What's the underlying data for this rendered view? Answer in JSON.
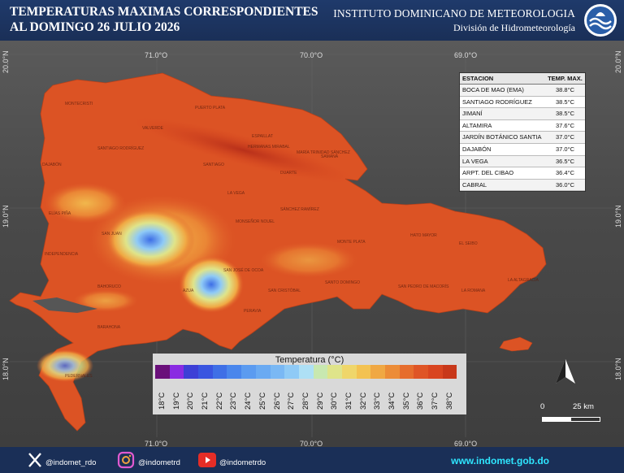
{
  "header": {
    "title_line1": "TEMPERATURAS MAXIMAS CORRESPONDIENTES",
    "title_line2": "AL DOMINGO 26  JULIO 2026",
    "institute": "INSTITUTO DOMINICANO DE METEOROLOGIA",
    "division": "División de Hidrometeorología"
  },
  "axes": {
    "lon_top": [
      "71.0°O",
      "70.0°O",
      "69.0°O"
    ],
    "lon_bottom": [
      "71.0°O",
      "70.0°O",
      "69.0°O"
    ],
    "lat_left": [
      "20.0°N",
      "19.0°N",
      "18.0°N"
    ],
    "lat_right": [
      "20.0°N",
      "19.0°N",
      "18.0°N"
    ]
  },
  "stations_table": {
    "header_station": "ESTACION",
    "header_temp": "TEMP. MAX.",
    "rows": [
      {
        "station": "BOCA DE MAO (EMA)",
        "temp": "38.8°C"
      },
      {
        "station": "SANTIAGO RODRÍGUEZ",
        "temp": "38.5°C"
      },
      {
        "station": "JIMANÍ",
        "temp": "38.5°C"
      },
      {
        "station": "ALTAMIRA",
        "temp": "37.6°C"
      },
      {
        "station": "JARDÍN BOTÁNICO SANTIA",
        "temp": "37.0°C"
      },
      {
        "station": "DAJABÓN",
        "temp": "37.0°C"
      },
      {
        "station": "LA VEGA",
        "temp": "36.5°C"
      },
      {
        "station": "ARPT. DEL CIBAO",
        "temp": "36.4°C"
      },
      {
        "station": "CABRAL",
        "temp": "36.0°C"
      }
    ]
  },
  "legend": {
    "title": "Temperatura (°C)",
    "labels": [
      "18°C",
      "19°C",
      "20°C",
      "21°C",
      "22°C",
      "23°C",
      "24°C",
      "25°C",
      "26°C",
      "27°C",
      "28°C",
      "29°C",
      "30°C",
      "31°C",
      "32°C",
      "33°C",
      "34°C",
      "35°C",
      "36°C",
      "37°C",
      "38°C"
    ],
    "colors": [
      "#6a0f7a",
      "#8a2be2",
      "#3d3fd6",
      "#3a55e0",
      "#3f6fe6",
      "#4a86ec",
      "#5b9bf0",
      "#6aaaf2",
      "#7ab8f4",
      "#8fcaf6",
      "#aee0f5",
      "#c8e8b0",
      "#dfe48a",
      "#efd66a",
      "#f3c251",
      "#f0a843",
      "#ec8c37",
      "#e66d2d",
      "#df5526",
      "#d94520",
      "#c8381a"
    ]
  },
  "map": {
    "provinces": [
      "MONTECRISTI",
      "PUERTO PLATA",
      "ESPAILLAT",
      "SAMANÁ",
      "DAJABÓN",
      "SANTIAGO",
      "DUARTE",
      "MARÍA TRINIDAD SÁNCHEZ",
      "SANTIAGO RODRÍGUEZ",
      "VALVERDE",
      "HERMANAS MIRABAL",
      "MONSEÑOR NOUEL",
      "SÁNCHEZ RAMÍREZ",
      "LA VEGA",
      "ELÍAS PIÑA",
      "SAN JUAN",
      "AZUA",
      "SAN CRISTÓBAL",
      "SANTO DOMINGO",
      "MONTE PLATA",
      "HATO MAYOR",
      "EL SEIBO",
      "LA ALTAGRACIA",
      "LA ROMANA",
      "SAN PEDRO DE MACORÍS",
      "INDEPENDENCIA",
      "BAHORUCO",
      "BARAHONA",
      "PEDERNALES",
      "PERAVIA",
      "SAN JOSÉ DE OCOA"
    ],
    "scale_zero": "0",
    "scale_label": "25 km",
    "north_label": "N"
  },
  "footer": {
    "x_handle": "@indomet_rdo",
    "instagram_handle": "@indometrd",
    "youtube_handle": "@indometrdo",
    "website": "www.indomet.gob.do"
  },
  "colors": {
    "header_bg": "#1f3a6b",
    "website": "#2ee6ff"
  }
}
